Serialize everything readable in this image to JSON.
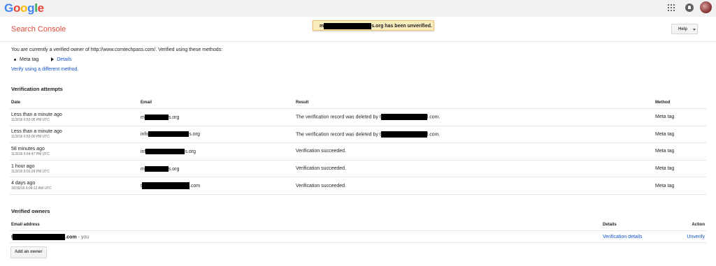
{
  "topbar": {
    "logo": [
      "G",
      "o",
      "o",
      "g",
      "l",
      "e"
    ],
    "logo_colors": [
      "#4285f4",
      "#ea4335",
      "#fbbc05",
      "#4285f4",
      "#34a853",
      "#ea4335"
    ]
  },
  "header": {
    "product_title": "Search Console",
    "toast_prefix": "m",
    "toast_suffix": "s.org has been unverified.",
    "help_label": "Help"
  },
  "intro": {
    "text": "You are currently a verified owner of http://www.comtechpass.com/. Verified using these methods:",
    "method": "Meta tag",
    "details_link": "Details",
    "verify_different": "Verify using a different method."
  },
  "attempts": {
    "title": "Verification attempts",
    "columns": [
      "Date",
      "Email",
      "Result",
      "Method"
    ],
    "rows": [
      {
        "date": "Less than a minute ago",
        "timestamp": "11/3/16 6:53:05 PM UTC",
        "email_prefix": "m",
        "email_suffix": "s.org",
        "result_text": "The verification record was deleted by t",
        "result_suffix": "l.com.",
        "result_redacted": true,
        "method": "Meta tag"
      },
      {
        "date": "Less than a minute ago",
        "timestamp": "11/3/16 6:53:00 PM UTC",
        "email_prefix": "info",
        "email_suffix": "s.org",
        "result_text": "The verification record was deleted by t",
        "result_suffix": "l.com.",
        "result_redacted": true,
        "method": "Meta tag"
      },
      {
        "date": "58 minutes ago",
        "timestamp": "11/3/16 5:54:47 PM UTC",
        "email_prefix": "inf",
        "email_suffix": "s.org",
        "result_text": "Verification succeeded.",
        "result_suffix": "",
        "result_redacted": false,
        "method": "Meta tag"
      },
      {
        "date": "1 hour ago",
        "timestamp": "11/3/16 5:01:29 PM UTC",
        "email_prefix": "m",
        "email_suffix": "s.org",
        "result_text": "Verification succeeded.",
        "result_suffix": "",
        "result_redacted": false,
        "method": "Meta tag"
      },
      {
        "date": "4 days ago",
        "timestamp": "10/30/16 6:04:12 AM UTC",
        "email_prefix": "t",
        "email_suffix": ".com",
        "result_text": "Verification succeeded.",
        "result_suffix": "",
        "result_redacted": false,
        "method": "Meta tag"
      }
    ]
  },
  "owners": {
    "title": "Verified owners",
    "columns": [
      "Email address",
      "Details",
      "Action"
    ],
    "row": {
      "email_prefix": "t",
      "email_suffix": ".com",
      "you": " - you",
      "details_link": "Verification details",
      "action_link": "Unverify"
    },
    "add_button": "Add an owner"
  }
}
